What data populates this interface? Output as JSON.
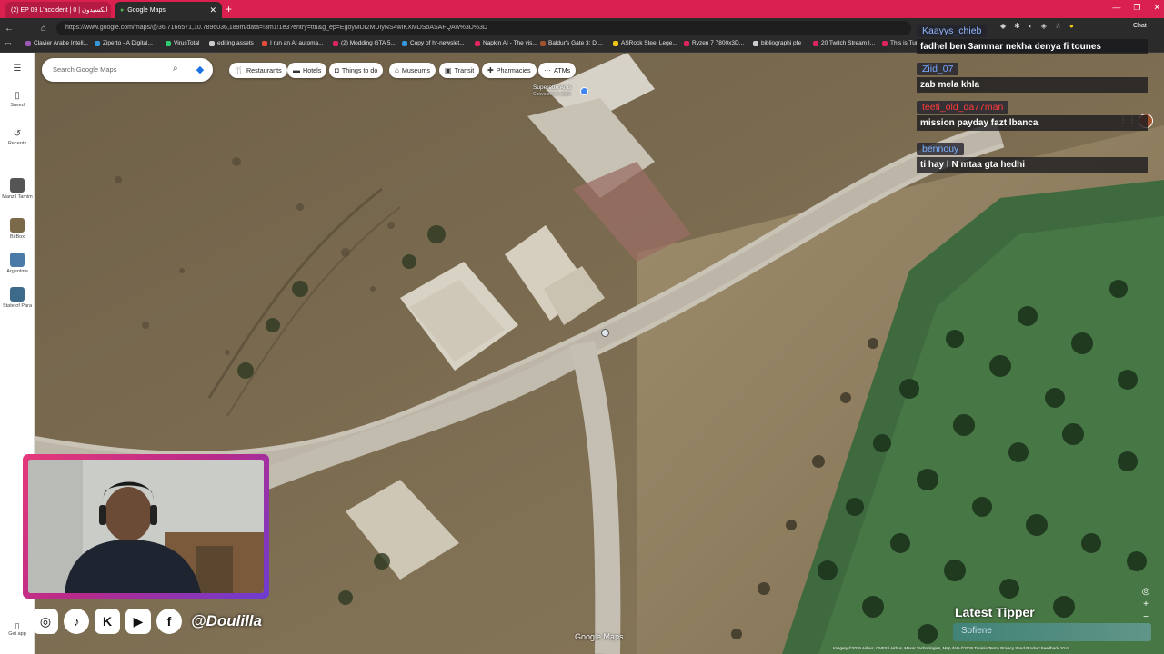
{
  "browser": {
    "tabs": [
      {
        "label": "(2) EP 09 L'accident | 0 | الكسيدون",
        "active": false
      },
      {
        "label": "Google Maps",
        "active": true
      }
    ],
    "url": "https://www.google.com/maps/@36.7166571,10.7896036,189m/data=!3m1!1e3?entry=ttu&g_ep=EgoyMDI2MDIyNS4wIKXMDSoASAFQAw%3D%3D",
    "chat_label": "Chat",
    "bookmarks": [
      "Clavier Arabe Intell...",
      "Ziperto - A Digital...",
      "VirusTotal",
      "editing assets",
      "I run an AI automa...",
      "(2) Modding GTA 5...",
      "Copy of hr-newslet...",
      "Napkin AI - The vis...",
      "Baldur's Gate 3: Di...",
      "ASRock Steel Lege...",
      "Ryzen 7 7800x3D...",
      "bibliographi pfe",
      "20 Twitch Stream I...",
      "This is Tun"
    ]
  },
  "maps": {
    "search_placeholder": "Search Google Maps",
    "rail": [
      {
        "label": "Saved",
        "icon": "bookmark-icon"
      },
      {
        "label": "Recents",
        "icon": "history-icon"
      },
      {
        "label": "Manzil Tamim ...",
        "icon": "thumb"
      },
      {
        "label": "BitBox",
        "icon": "thumb"
      },
      {
        "label": "Argentina",
        "icon": "thumb"
      },
      {
        "label": "State of Para",
        "icon": "thumb"
      }
    ],
    "get_app": "Get app",
    "chips": [
      "Restaurants",
      "Hotels",
      "Things to do",
      "Museums",
      "Transit",
      "Pharmacies",
      "ATMs"
    ],
    "place_name": "Superette Anis",
    "place_type": "Convenience store",
    "watermark": "Google Maps",
    "attribution": "Imagery ©2026 Airbus, CNES / Airbus, Maxar Technologies, Map data ©2026   Tunisia   Terms   Privacy   Send Product Feedback   10 m"
  },
  "chat": [
    {
      "user": "Kaayys_chieb",
      "user_color": "#8fb8ff",
      "text": "fadhel ben 3ammar nekha denya fi tounes"
    },
    {
      "user": "Ziid_07",
      "user_color": "#7aa8ff",
      "text": "zab mela khla"
    },
    {
      "user": "teeti_old_da77man",
      "user_color": "#ff3b3b",
      "text": "mission payday fazt lbanca"
    },
    {
      "user": "bennouy",
      "user_color": "#7ab0ff",
      "text": "ti hay l N mtaa gta hedhi"
    }
  ],
  "overlay": {
    "handle": "@Doulilla",
    "latest_tipper_title": "Latest Tipper",
    "latest_tipper_name": "Sofiene"
  },
  "colors": {
    "tabbar": "#d9204f",
    "webcam_border_start": "#e5397a",
    "webcam_border_end": "#6c3cd2"
  }
}
